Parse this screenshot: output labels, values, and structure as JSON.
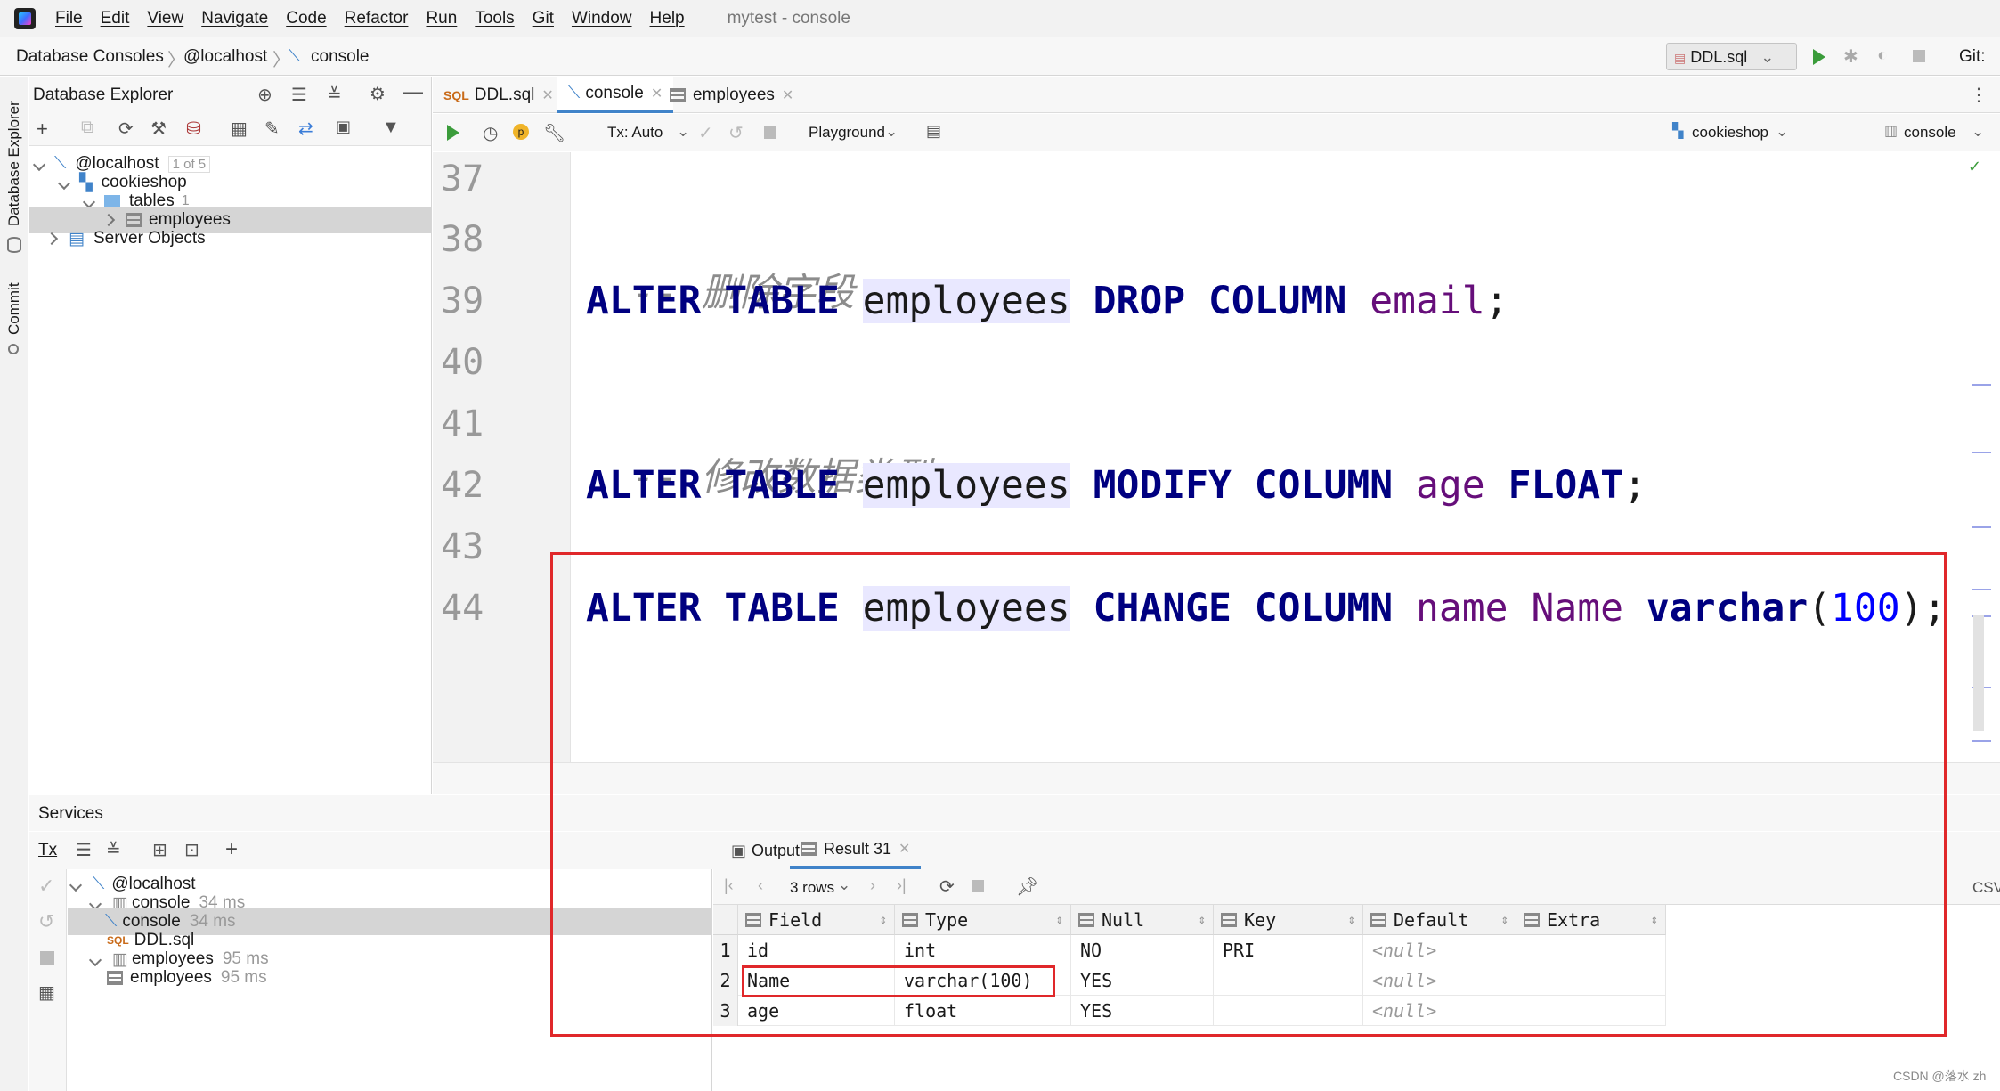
{
  "menubar": {
    "items": [
      "File",
      "Edit",
      "View",
      "Navigate",
      "Code",
      "Refactor",
      "Run",
      "Tools",
      "Git",
      "Window",
      "Help"
    ],
    "window_title": "mytest - console"
  },
  "breadcrumb": {
    "items": [
      "Database Consoles",
      "@localhost",
      "console"
    ]
  },
  "run_config": {
    "label": "DDL.sql",
    "git_label": "Git:"
  },
  "left_strip": {
    "tabs": [
      "Database Explorer",
      "Commit"
    ]
  },
  "db_explorer": {
    "title": "Database Explorer",
    "tree": {
      "host": "@localhost",
      "host_badge": "1 of 5",
      "schema": "cookieshop",
      "tables_label": "tables",
      "tables_count": "1",
      "table": "employees",
      "server_objects": "Server Objects"
    }
  },
  "editor": {
    "tabs": [
      {
        "label": "DDL.sql",
        "icon": "sql-file-icon"
      },
      {
        "label": "console",
        "icon": "console-icon"
      },
      {
        "label": "employees",
        "icon": "table-icon"
      }
    ],
    "toolbar": {
      "tx_label": "Tx: Auto",
      "playground_label": "Playground",
      "schema_label": "cookieshop",
      "session_label": "console"
    },
    "line_numbers": [
      "37",
      "38",
      "39",
      "40",
      "41",
      "42",
      "43",
      "44"
    ],
    "lines": {
      "l38_comment": "-- 删除字段",
      "l39": {
        "kw1": "ALTER TABLE",
        "tbl": "employees",
        "kw2": "DROP COLUMN",
        "col": "email",
        "end": ";"
      },
      "l41_comment": "-- 修改数据类型",
      "l42": {
        "kw1": "ALTER TABLE",
        "tbl": "employees",
        "kw2": "MODIFY COLUMN",
        "col": "age",
        "type": "FLOAT",
        "end": ";"
      },
      "l44": {
        "kw1": "ALTER TABLE",
        "tbl": "employees",
        "kw2": "CHANGE COLUMN",
        "col1": "name",
        "col2": "Name",
        "type": "varchar",
        "paren_open": "(",
        "num": "100",
        "end": ");"
      }
    }
  },
  "services": {
    "title": "Services",
    "tx_label": "Tx",
    "tree": [
      {
        "label": "@localhost",
        "time": ""
      },
      {
        "label": "console",
        "time": "34 ms"
      },
      {
        "label": "console",
        "time": "34 ms"
      },
      {
        "label": "DDL.sql",
        "time": ""
      },
      {
        "label": "employees",
        "time": "95 ms"
      },
      {
        "label": "employees",
        "time": "95 ms"
      }
    ]
  },
  "results": {
    "tabs": [
      "Output",
      "Result 31"
    ],
    "rows_label": "3 rows",
    "csv_label": "CSV",
    "columns": [
      "Field",
      "Type",
      "Null",
      "Key",
      "Default",
      "Extra"
    ],
    "rows": [
      [
        "id",
        "int",
        "NO",
        "PRI",
        "<null>",
        ""
      ],
      [
        "Name",
        "varchar(100)",
        "YES",
        "",
        "<null>",
        ""
      ],
      [
        "age",
        "float",
        "YES",
        "",
        "<null>",
        ""
      ]
    ],
    "row_numbers": [
      "1",
      "2",
      "3"
    ]
  },
  "watermark": "CSDN @落水 zh",
  "colors": {
    "keyword": "#000080",
    "column": "#660e7a",
    "number": "#0000ff",
    "highlight_box": "#e0282a",
    "accent": "#4083c9"
  }
}
